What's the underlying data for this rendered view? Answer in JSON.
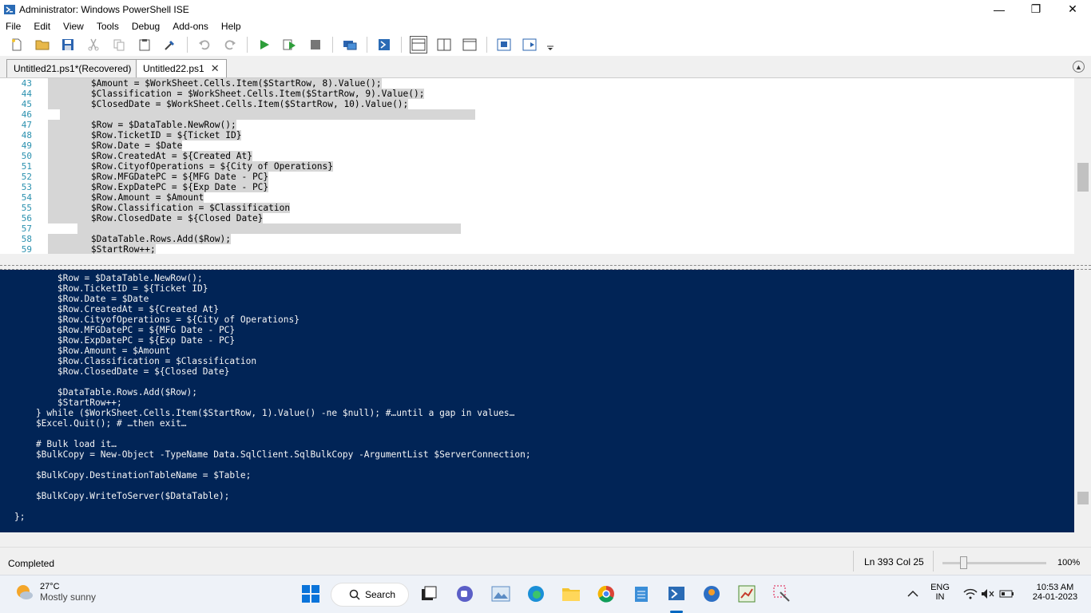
{
  "window": {
    "title": "Administrator: Windows PowerShell ISE",
    "controls": {
      "minimize": "—",
      "restore": "❐",
      "close": "✕"
    }
  },
  "menu": [
    "File",
    "Edit",
    "View",
    "Tools",
    "Debug",
    "Add-ons",
    "Help"
  ],
  "tabs": [
    {
      "label": "Untitled21.ps1*(Recovered)",
      "active": false
    },
    {
      "label": "Untitled22.ps1",
      "active": true,
      "close": "✕"
    }
  ],
  "script": {
    "line_numbers": [
      "43",
      "44",
      "45",
      "46",
      "47",
      "48",
      "49",
      "50",
      "51",
      "52",
      "53",
      "54",
      "55",
      "56",
      "57",
      "58",
      "59"
    ],
    "lines": [
      "        $Amount = $WorkSheet.Cells.Item($StartRow, 8).Value();",
      "        $Classification = $WorkSheet.Cells.Item($StartRow, 9).Value();",
      "        $ClosedDate = $WorkSheet.Cells.Item($StartRow, 10).Value();",
      "",
      "        $Row = $DataTable.NewRow();",
      "        $Row.TicketID = ${Ticket ID}",
      "        $Row.Date = $Date",
      "        $Row.CreatedAt = ${Created At}",
      "        $Row.CityofOperations = ${City of Operations}",
      "        $Row.MFGDatePC = ${MFG Date - PC}",
      "        $Row.ExpDatePC = ${Exp Date - PC}",
      "        $Row.Amount = $Amount",
      "        $Row.Classification = $Classification",
      "        $Row.ClosedDate = ${Closed Date}",
      "",
      "        $DataTable.Rows.Add($Row);",
      "        $StartRow++;"
    ]
  },
  "console": {
    "lines": [
      "        $Row = $DataTable.NewRow();",
      "        $Row.TicketID = ${Ticket ID}",
      "        $Row.Date = $Date",
      "        $Row.CreatedAt = ${Created At}",
      "        $Row.CityofOperations = ${City of Operations}",
      "        $Row.MFGDatePC = ${MFG Date - PC}",
      "        $Row.ExpDatePC = ${Exp Date - PC}",
      "        $Row.Amount = $Amount",
      "        $Row.Classification = $Classification",
      "        $Row.ClosedDate = ${Closed Date}",
      "",
      "        $DataTable.Rows.Add($Row);",
      "        $StartRow++;",
      "    } while ($WorkSheet.Cells.Item($StartRow, 1).Value() -ne $null); #…until a gap in values…",
      "    $Excel.Quit(); # …then exit…",
      "",
      "    # Bulk load it…",
      "    $BulkCopy = New-Object -TypeName Data.SqlClient.SqlBulkCopy -ArgumentList $ServerConnection;",
      "",
      "    $BulkCopy.DestinationTableName = $Table;",
      "",
      "    $BulkCopy.WriteToServer($DataTable);",
      "",
      "};"
    ]
  },
  "status": {
    "text": "Completed",
    "position": "Ln 393  Col 25",
    "zoom": "100%",
    "zoom_level": 0.17
  },
  "taskbar": {
    "temp": "27°C",
    "condition": "Mostly sunny",
    "search": "Search",
    "lang1": "ENG",
    "lang2": "IN",
    "time": "10:53 AM",
    "date": "24-01-2023"
  }
}
